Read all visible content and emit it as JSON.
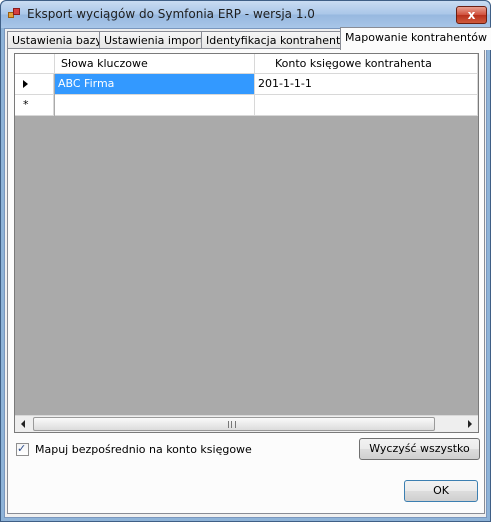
{
  "window": {
    "title": "Eksport wyciągów do Symfonia ERP - wersja 1.0",
    "close_label": "x"
  },
  "tabs": [
    {
      "label": "Ustawienia bazy",
      "active": false
    },
    {
      "label": "Ustawienia importu",
      "active": false
    },
    {
      "label": "Identyfikacja kontrahentów",
      "active": false
    },
    {
      "label": "Mapowanie kontrahentów",
      "active": true
    }
  ],
  "grid": {
    "columns": [
      "Słowa kluczowe",
      "Konto księgowe kontrahenta"
    ],
    "rows": [
      {
        "keyword": "ABC Firma",
        "account": "201-1-1-1",
        "selected": true
      }
    ],
    "new_row_marker": "*"
  },
  "options": {
    "direct_mapping_label": "Mapuj bezpośrednio na konto księgowe",
    "direct_mapping_checked": true,
    "check_glyph": "✓"
  },
  "buttons": {
    "clear_all": "Wyczyść wszystko",
    "ok": "OK"
  },
  "scrollbar": {
    "grip": "III"
  }
}
